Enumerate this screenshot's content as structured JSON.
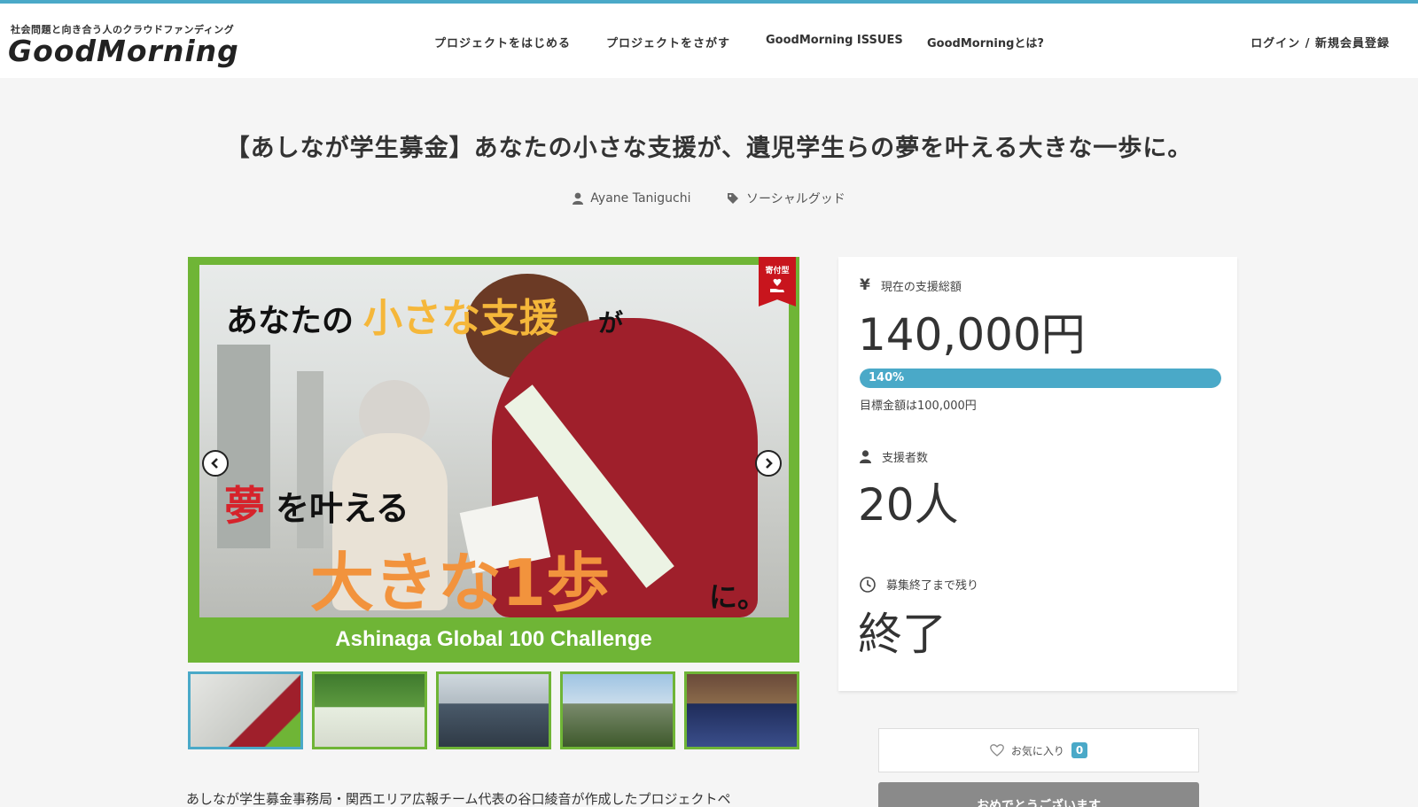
{
  "header": {
    "logo_tagline": "社会問題と向き合う人のクラウドファンディング",
    "logo_text": "GoodMorning",
    "nav": [
      {
        "label": "プロジェクトをはじめる"
      },
      {
        "label": "プロジェクトをさがす"
      },
      {
        "label": "GoodMorning ISSUES"
      },
      {
        "label": "GoodMorningとは?"
      }
    ],
    "login_label": "ログイン / 新規会員登録"
  },
  "project": {
    "title": "【あしなが学生募金】あなたの小さな支援が、遺児学生らの夢を叶える大きな一歩に。",
    "author": "Ayane Taniguchi",
    "category": "ソーシャルグッド",
    "description": "あしなが学生募金事務局・関西エリア広報チーム代表の谷口綾音が作成したプロジェクトペ"
  },
  "main_image": {
    "ribbon_label": "寄付型",
    "overlay": {
      "line1_a": "あなたの",
      "line1_b": "小さな支援",
      "line1_c": "が",
      "line2_a": "夢",
      "line2_b": "を叶える",
      "line3_a": "大きな1歩",
      "line3_b": "に。"
    },
    "caption": "Ashinaga Global 100 Challenge",
    "prev_icon": "chevron-left-icon",
    "next_icon": "chevron-right-icon"
  },
  "thumbnails": [
    {
      "name": "thumb-1",
      "active": true
    },
    {
      "name": "thumb-2",
      "active": false
    },
    {
      "name": "thumb-3",
      "active": false
    },
    {
      "name": "thumb-4",
      "active": false
    },
    {
      "name": "thumb-5",
      "active": false
    }
  ],
  "stats": {
    "amount_label": "現在の支援総額",
    "amount_value": "140,000円",
    "progress_percent": 140,
    "progress_label": "140%",
    "goal_text": "目標金額は100,000円",
    "supporters_label": "支援者数",
    "supporters_value": "20人",
    "remaining_label": "募集終了まで残り",
    "remaining_value": "終了"
  },
  "actions": {
    "favorite_label": "お気に入り",
    "favorite_count": "0",
    "congrats_label": "おめでとうございます"
  },
  "colors": {
    "accent": "#4aa9c8",
    "frame_green": "#6fb536",
    "ribbon_red": "#c8151d",
    "overlay_orange": "#f2933d",
    "overlay_red": "#d6232b"
  }
}
